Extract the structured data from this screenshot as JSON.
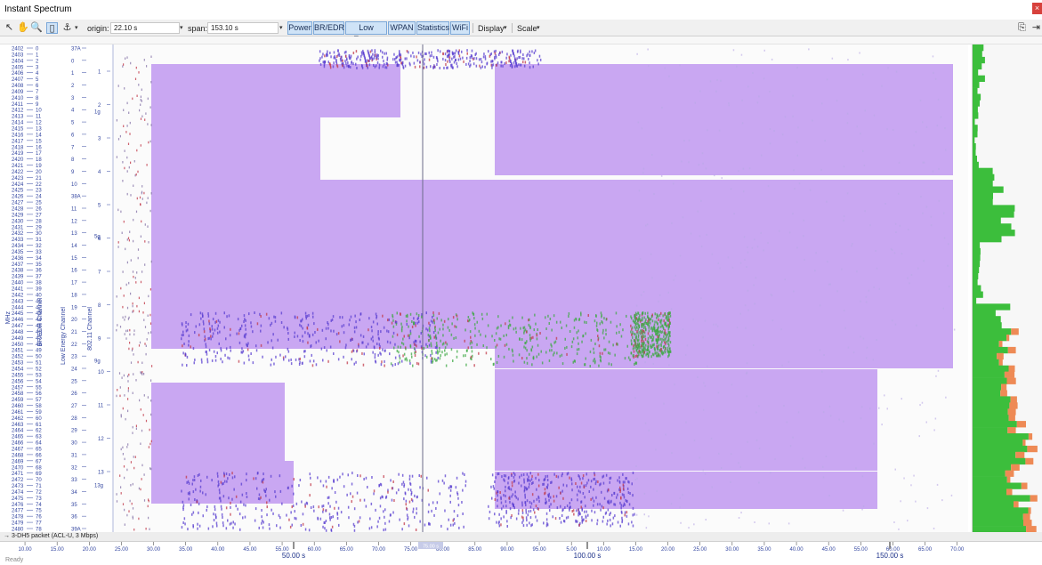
{
  "window": {
    "title": "Instant Spectrum",
    "close_glyph": "×"
  },
  "toolbar": {
    "icons": [
      "pointer-icon",
      "hand-icon",
      "zoom-icon",
      "panel-icon",
      "marker-icon"
    ],
    "origin_label": "origin:",
    "origin_value": "22.10 s",
    "span_label": "span:",
    "span_value": "153.10 s",
    "toggles": [
      "Power",
      "BR/EDR",
      "Low Energy",
      "WPAN",
      "Statistics",
      "WiFi"
    ],
    "menus": [
      "Display",
      "Scale"
    ],
    "right_icons": [
      "copy-icon",
      "export-icon"
    ]
  },
  "axes": {
    "mhz_label": "MHz",
    "bredr_label": "BR/EDR Channel",
    "le_label": "Low Energy Channel",
    "wifi_label": "802.11 Channel",
    "mhz_ticks": [
      "2402",
      "2403",
      "2404",
      "2405",
      "2406",
      "2407",
      "2408",
      "2409",
      "2410",
      "2411",
      "2412",
      "2413",
      "2414",
      "2415",
      "2416",
      "2417",
      "2418",
      "2419",
      "2420",
      "2421",
      "2422",
      "2423",
      "2424",
      "2425",
      "2426",
      "2427",
      "2428",
      "2429",
      "2430",
      "2431",
      "2432",
      "2433",
      "2434",
      "2435",
      "2436",
      "2437",
      "2438",
      "2439",
      "2440",
      "2441",
      "2442",
      "2443",
      "2444",
      "2445",
      "2446",
      "2447",
      "2448",
      "2449",
      "2450",
      "2451",
      "2452",
      "2453",
      "2454",
      "2455",
      "2456",
      "2457",
      "2458",
      "2459",
      "2460",
      "2461",
      "2462",
      "2463",
      "2464",
      "2465",
      "2466",
      "2467",
      "2468",
      "2469",
      "2470",
      "2471",
      "2472",
      "2473",
      "2474",
      "2475",
      "2476",
      "2477",
      "2478",
      "2479",
      "2480"
    ],
    "le_ticks": [
      "37A",
      "0",
      "1",
      "2",
      "3",
      "4",
      "5",
      "6",
      "7",
      "8",
      "9",
      "10",
      "38A",
      "11",
      "12",
      "13",
      "14",
      "15",
      "16",
      "17",
      "18",
      "19",
      "20",
      "21",
      "22",
      "23",
      "24",
      "25",
      "26",
      "27",
      "28",
      "29",
      "30",
      "31",
      "32",
      "33",
      "34",
      "35",
      "36",
      "39A"
    ],
    "wifi_ticks": [
      "1",
      "2",
      "3",
      "4",
      "5",
      "6",
      "7",
      "8",
      "9",
      "10",
      "11",
      "12",
      "13"
    ],
    "wifi_g_ticks": [
      "1g",
      "5g",
      "9g",
      "13g"
    ]
  },
  "packet_tag": "3-DH5 packet (ACL-U, 3 Mbps)",
  "time_axis": {
    "minor_ticks": [
      "10.00",
      "15.00",
      "20.00",
      "25.00",
      "30.00",
      "35.00",
      "40.00",
      "45.00",
      "55.00",
      "60.00",
      "65.00",
      "70.00",
      "75.00",
      "80.00",
      "85.00",
      "90.00",
      "95.00",
      "5.00",
      "10.00",
      "15.00",
      "20.00",
      "25.00",
      "30.00",
      "35.00",
      "40.00",
      "45.00",
      "55.00",
      "60.00",
      "65.00",
      "70.00"
    ],
    "major_ticks": [
      "50.00 s",
      "100.00 s",
      "150.00 s"
    ],
    "cursor_label": "75.00 s"
  },
  "status": {
    "footer_text": "Ready"
  },
  "colors": {
    "activity_purple": "#c9a7f2",
    "packet_blue": "#5a3fd0",
    "packet_green": "#3fa845",
    "packet_red": "#c23a4a",
    "hist_green": "#3cbe3c",
    "hist_orange": "#ee8a55",
    "toggle_blue": "#cfe3f7"
  }
}
